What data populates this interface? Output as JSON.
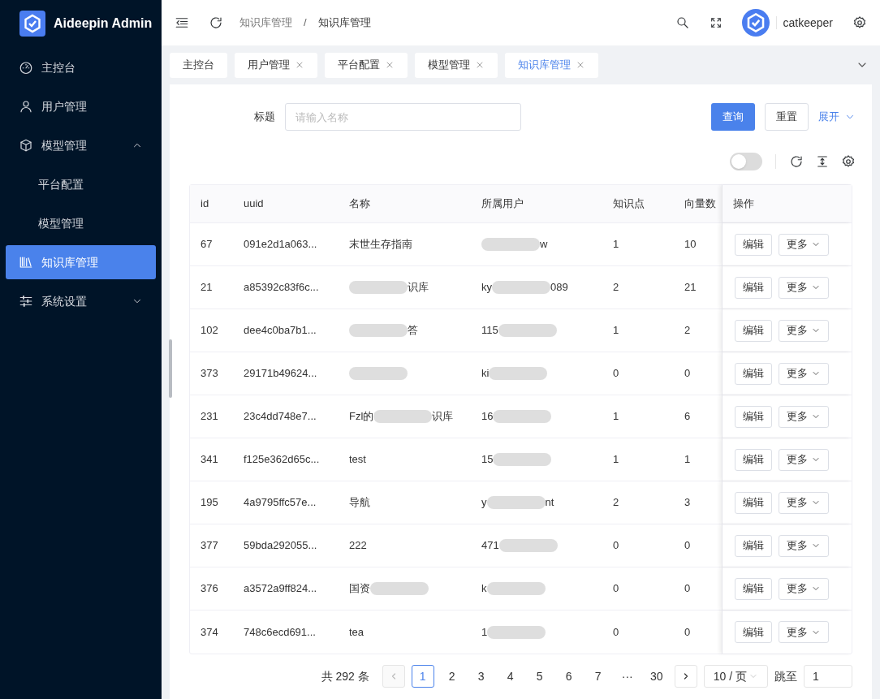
{
  "app": {
    "title": "Aideepin Admin"
  },
  "sidebar": {
    "items": [
      {
        "label": "主控台",
        "selected": false
      },
      {
        "label": "用户管理",
        "selected": false
      },
      {
        "label": "模型管理",
        "selected": false,
        "expanded": true,
        "children": [
          {
            "label": "平台配置",
            "selected": false
          },
          {
            "label": "模型管理",
            "selected": false
          }
        ]
      },
      {
        "label": "知识库管理",
        "selected": true
      },
      {
        "label": "系统设置",
        "selected": false,
        "expanded": false
      }
    ]
  },
  "header": {
    "breadcrumb": [
      "知识库管理",
      "知识库管理"
    ],
    "breadcrumb_separator": "/",
    "user": "catkeeper"
  },
  "tabs": [
    {
      "label": "主控台",
      "closable": false,
      "selected": false
    },
    {
      "label": "用户管理",
      "closable": true,
      "selected": false
    },
    {
      "label": "平台配置",
      "closable": true,
      "selected": false
    },
    {
      "label": "模型管理",
      "closable": true,
      "selected": false
    },
    {
      "label": "知识库管理",
      "closable": true,
      "selected": true
    }
  ],
  "search": {
    "label": "标题",
    "placeholder": "请输入名称",
    "buttons": [
      "查询",
      "重置"
    ],
    "expand": "展开"
  },
  "toolbar": {
    "toggle_on": false
  },
  "table": {
    "columns": [
      "id",
      "uuid",
      "名称",
      "所属用户",
      "知识点",
      "向量数",
      "操作"
    ],
    "rows": [
      {
        "id": "67",
        "uuid": "091e2d1a063...",
        "name": [
          {
            "kind": "text",
            "text": "末世生存指南"
          }
        ],
        "user": [
          {
            "kind": "redacted"
          },
          {
            "kind": "text",
            "text": "w"
          }
        ],
        "points": "1",
        "vectors": "10",
        "actions": [
          "编辑",
          "更多"
        ]
      },
      {
        "id": "21",
        "uuid": "a85392c83f6c...",
        "name": [
          {
            "kind": "redacted"
          },
          {
            "kind": "text",
            "text": "识库"
          }
        ],
        "user": [
          {
            "kind": "text",
            "text": "ky"
          },
          {
            "kind": "redacted"
          },
          {
            "kind": "text",
            "text": "089"
          }
        ],
        "points": "2",
        "vectors": "21",
        "actions": [
          "编辑",
          "更多"
        ]
      },
      {
        "id": "102",
        "uuid": "dee4c0ba7b1...",
        "name": [
          {
            "kind": "redacted"
          },
          {
            "kind": "text",
            "text": "答"
          }
        ],
        "user": [
          {
            "kind": "text",
            "text": "115"
          },
          {
            "kind": "redacted"
          }
        ],
        "points": "1",
        "vectors": "2",
        "actions": [
          "编辑",
          "更多"
        ]
      },
      {
        "id": "373",
        "uuid": "29171b49624...",
        "name": [
          {
            "kind": "redacted"
          }
        ],
        "user": [
          {
            "kind": "text",
            "text": "ki"
          },
          {
            "kind": "redacted"
          }
        ],
        "points": "0",
        "vectors": "0",
        "actions": [
          "编辑",
          "更多"
        ]
      },
      {
        "id": "231",
        "uuid": "23c4dd748e7...",
        "name": [
          {
            "kind": "text",
            "text": "Fzl的"
          },
          {
            "kind": "redacted"
          },
          {
            "kind": "text",
            "text": "识库"
          }
        ],
        "user": [
          {
            "kind": "text",
            "text": "16"
          },
          {
            "kind": "redacted"
          }
        ],
        "points": "1",
        "vectors": "6",
        "actions": [
          "编辑",
          "更多"
        ]
      },
      {
        "id": "341",
        "uuid": "f125e362d65c...",
        "name": [
          {
            "kind": "text",
            "text": "test"
          }
        ],
        "user": [
          {
            "kind": "text",
            "text": "15"
          },
          {
            "kind": "redacted"
          }
        ],
        "points": "1",
        "vectors": "1",
        "actions": [
          "编辑",
          "更多"
        ]
      },
      {
        "id": "195",
        "uuid": "4a9795ffc57e...",
        "name": [
          {
            "kind": "text",
            "text": "导航"
          }
        ],
        "user": [
          {
            "kind": "text",
            "text": "y"
          },
          {
            "kind": "redacted"
          },
          {
            "kind": "text",
            "text": "nt"
          }
        ],
        "points": "2",
        "vectors": "3",
        "actions": [
          "编辑",
          "更多"
        ]
      },
      {
        "id": "377",
        "uuid": "59bda292055...",
        "name": [
          {
            "kind": "text",
            "text": "222"
          }
        ],
        "user": [
          {
            "kind": "text",
            "text": "471"
          },
          {
            "kind": "redacted"
          }
        ],
        "points": "0",
        "vectors": "0",
        "actions": [
          "编辑",
          "更多"
        ]
      },
      {
        "id": "376",
        "uuid": "a3572a9ff824...",
        "name": [
          {
            "kind": "text",
            "text": "国资"
          },
          {
            "kind": "redacted"
          }
        ],
        "user": [
          {
            "kind": "text",
            "text": "k"
          },
          {
            "kind": "redacted"
          }
        ],
        "points": "0",
        "vectors": "0",
        "actions": [
          "编辑",
          "更多"
        ]
      },
      {
        "id": "374",
        "uuid": "748c6ecd691...",
        "name": [
          {
            "kind": "text",
            "text": "tea"
          }
        ],
        "user": [
          {
            "kind": "text",
            "text": "1"
          },
          {
            "kind": "redacted"
          }
        ],
        "points": "0",
        "vectors": "0",
        "actions": [
          "编辑",
          "更多"
        ]
      }
    ]
  },
  "pagination": {
    "total": "共 292 条",
    "pages": [
      {
        "label": "1",
        "selected": true
      },
      {
        "label": "2",
        "selected": false
      },
      {
        "label": "3",
        "selected": false
      },
      {
        "label": "4",
        "selected": false
      },
      {
        "label": "5",
        "selected": false
      },
      {
        "label": "6",
        "selected": false
      },
      {
        "label": "7",
        "selected": false
      },
      {
        "label": "···",
        "selected": false
      },
      {
        "label": "30",
        "selected": false
      }
    ],
    "page_size": "10 / 页",
    "jump_label": "跳至",
    "jump_value": "1"
  }
}
